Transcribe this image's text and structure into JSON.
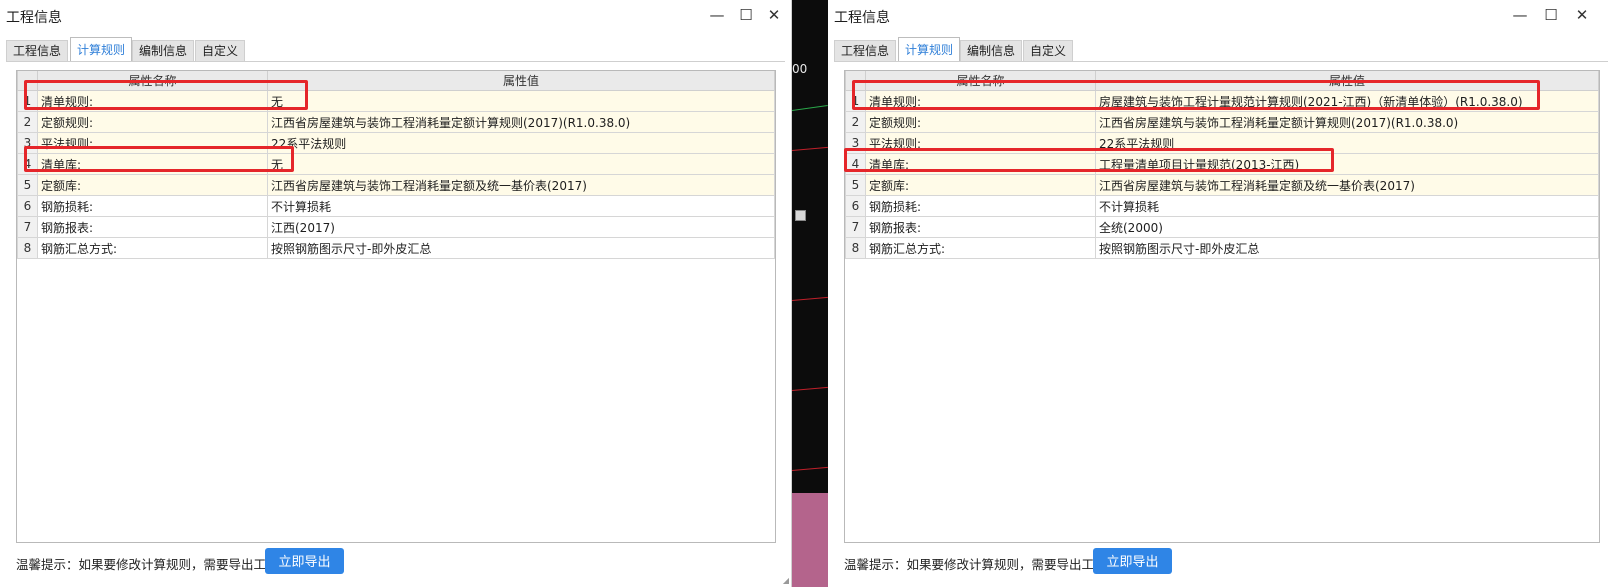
{
  "dialogs": [
    {
      "title": "工程信息",
      "tabs": [
        {
          "label": "工程信息",
          "active": false
        },
        {
          "label": "计算规则",
          "active": true
        },
        {
          "label": "编制信息",
          "active": false
        },
        {
          "label": "自定义",
          "active": false
        }
      ],
      "columns": [
        "属性名称",
        "属性值"
      ],
      "rows": [
        {
          "num": "1",
          "name": "清单规则:",
          "value": "无"
        },
        {
          "num": "2",
          "name": "定额规则:",
          "value": "江西省房屋建筑与装饰工程消耗量定额计算规则(2017)(R1.0.38.0)"
        },
        {
          "num": "3",
          "name": "平法规则:",
          "value": "22系平法规则"
        },
        {
          "num": "4",
          "name": "清单库:",
          "value": "无"
        },
        {
          "num": "5",
          "name": "定额库:",
          "value": "江西省房屋建筑与装饰工程消耗量定额及统一基价表(2017)"
        },
        {
          "num": "6",
          "name": "钢筋损耗:",
          "value": "不计算损耗"
        },
        {
          "num": "7",
          "name": "钢筋报表:",
          "value": "江西(2017)"
        },
        {
          "num": "8",
          "name": "钢筋汇总方式:",
          "value": "按照钢筋图示尺寸-即外皮汇总"
        }
      ],
      "tip": "温馨提示：如果要修改计算规则，需要导出工程",
      "export_label": "立即导出"
    },
    {
      "title": "工程信息",
      "tabs": [
        {
          "label": "工程信息",
          "active": false
        },
        {
          "label": "计算规则",
          "active": true
        },
        {
          "label": "编制信息",
          "active": false
        },
        {
          "label": "自定义",
          "active": false
        }
      ],
      "columns": [
        "属性名称",
        "属性值"
      ],
      "rows": [
        {
          "num": "1",
          "name": "清单规则:",
          "value": "房屋建筑与装饰工程计量规范计算规则(2021-江西)（新清单体验）(R1.0.38.0)"
        },
        {
          "num": "2",
          "name": "定额规则:",
          "value": "江西省房屋建筑与装饰工程消耗量定额计算规则(2017)(R1.0.38.0)"
        },
        {
          "num": "3",
          "name": "平法规则:",
          "value": "22系平法规则"
        },
        {
          "num": "4",
          "name": "清单库:",
          "value": "工程量清单项目计量规范(2013-江西)"
        },
        {
          "num": "5",
          "name": "定额库:",
          "value": "江西省房屋建筑与装饰工程消耗量定额及统一基价表(2017)"
        },
        {
          "num": "6",
          "name": "钢筋损耗:",
          "value": "不计算损耗"
        },
        {
          "num": "7",
          "name": "钢筋报表:",
          "value": "全统(2000)"
        },
        {
          "num": "8",
          "name": "钢筋汇总方式:",
          "value": "按照钢筋图示尺寸-即外皮汇总"
        }
      ],
      "tip": "温馨提示：如果要修改计算规则，需要导出工程",
      "export_label": "立即导出"
    }
  ],
  "background_text": "00",
  "window_controls": {
    "minimize": "—",
    "maximize": "☐",
    "close": "✕"
  },
  "colors": {
    "highlight": "#e5262a",
    "accent": "#2f85e6",
    "active_tab": "#2f7fd8",
    "row_yellow": "#fffbe8"
  },
  "icons": {
    "minimize": "minimize-icon",
    "maximize": "maximize-icon",
    "close": "close-icon"
  }
}
